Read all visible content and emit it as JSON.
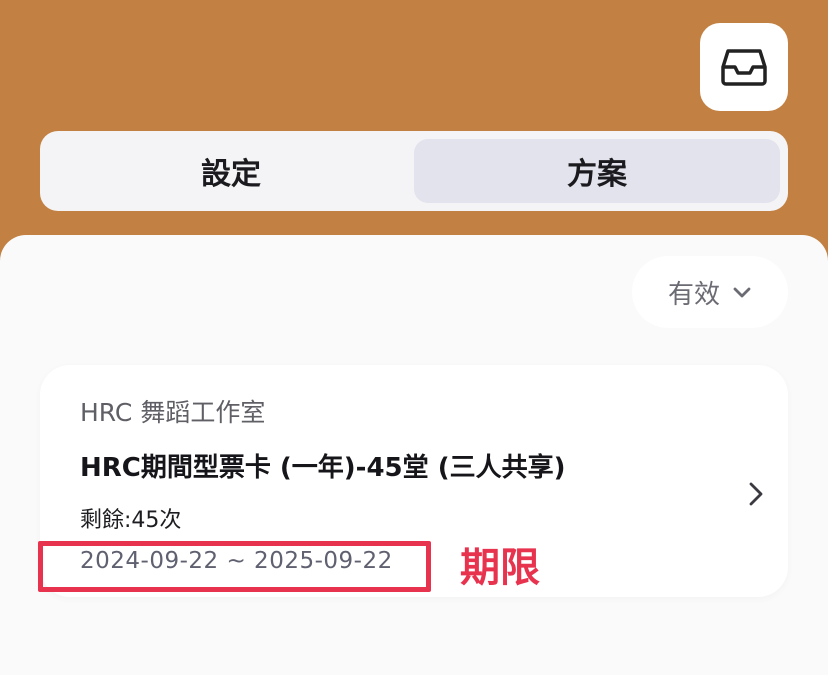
{
  "header": {
    "inbox_icon": "inbox-tray-icon",
    "tabs": [
      {
        "label": "設定",
        "selected": false
      },
      {
        "label": "方案",
        "selected": true
      }
    ]
  },
  "filter": {
    "label": "有效",
    "icon": "chevron-down-icon"
  },
  "plan_card": {
    "studio": "HRC 舞蹈工作室",
    "plan_name": "HRC期間型票卡 (一年)-45堂 (三人共享)",
    "remaining": "剩餘:45次",
    "period": "2024-09-22 ~ 2025-09-22",
    "chevron_icon": "chevron-right-icon"
  },
  "annotation": {
    "label": "期限",
    "color": "#e8334f"
  },
  "colors": {
    "brand": "#c28142",
    "accent_annotation": "#e8334f"
  }
}
